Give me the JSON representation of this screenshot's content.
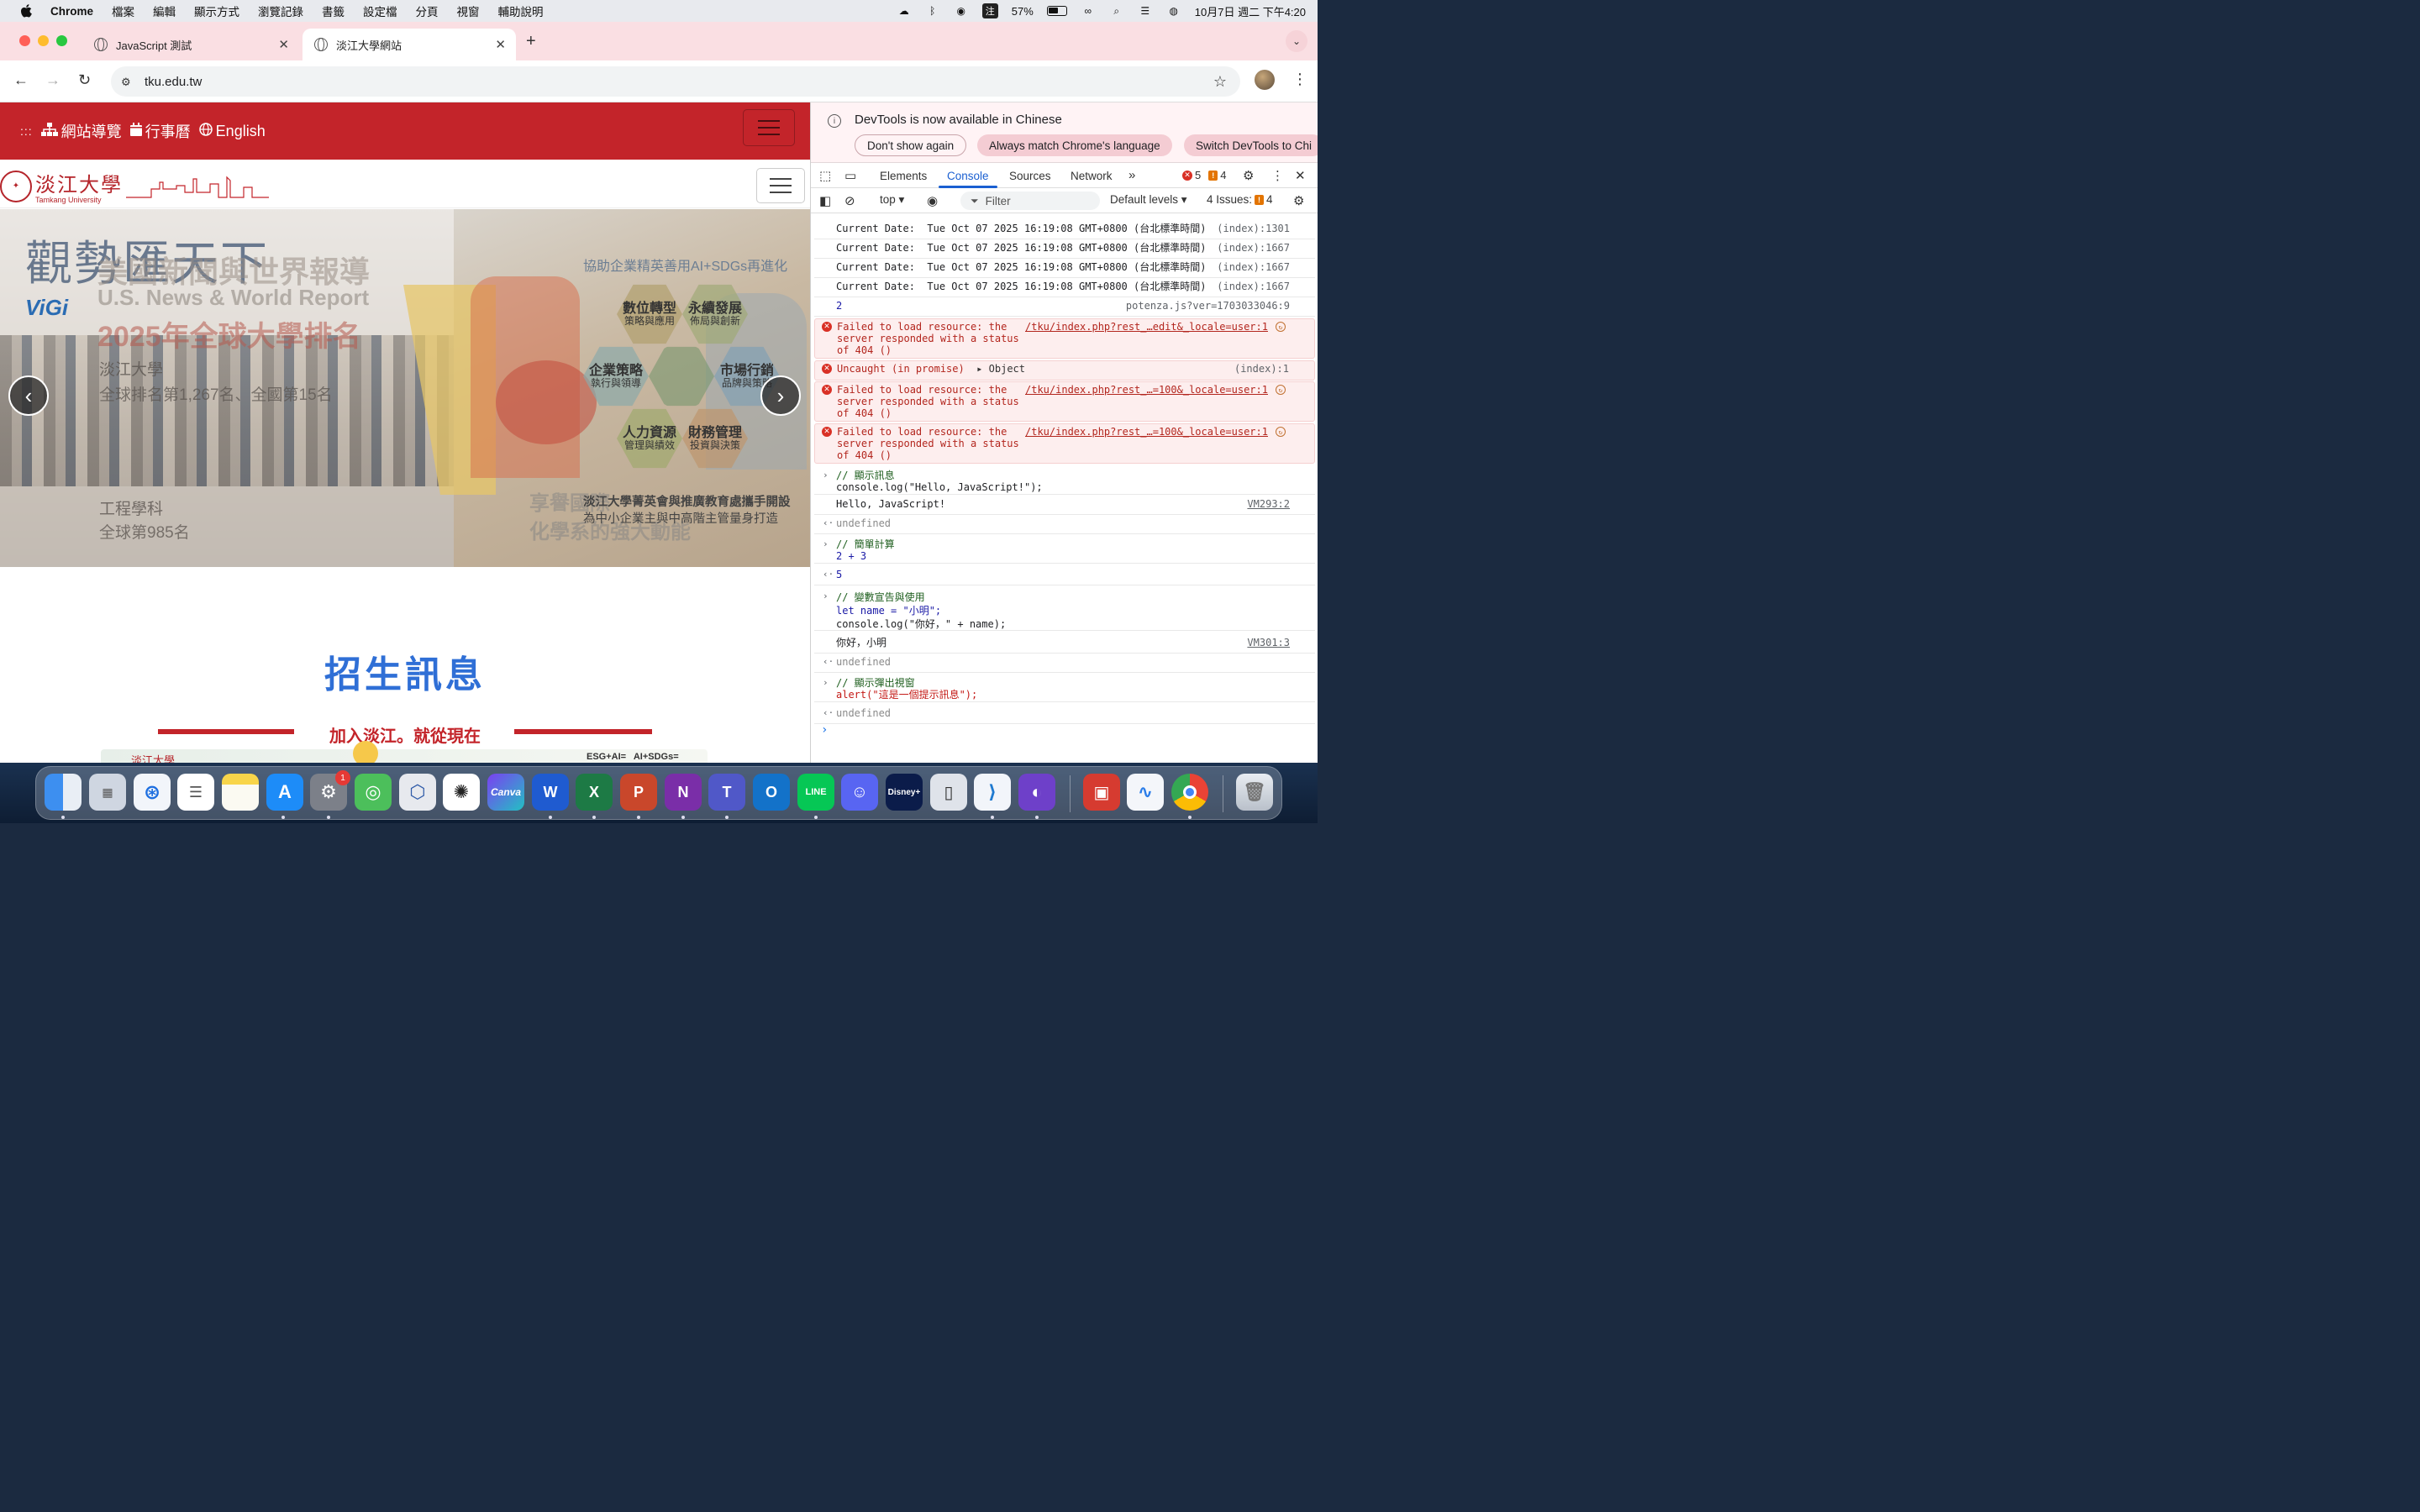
{
  "menubar": {
    "app": "Chrome",
    "items": [
      "檔案",
      "編輯",
      "顯示方式",
      "瀏覽記錄",
      "書籤",
      "設定檔",
      "分頁",
      "視窗",
      "輔助說明"
    ],
    "ime": "注",
    "battery": "57%",
    "datetime": "10月7日 週二 下午4:20"
  },
  "browser": {
    "tabs": [
      {
        "title": "JavaScript 測試",
        "active": false
      },
      {
        "title": "淡江大學網站",
        "active": true
      }
    ],
    "url": "tku.edu.tw"
  },
  "site": {
    "nav": {
      "sitemap": "網站導覽",
      "calendar": "行事曆",
      "english": "English"
    },
    "logo": {
      "zh": "淡江大學",
      "en": "Tamkang University"
    },
    "carousel": {
      "headline_script": "觀勢匯天下",
      "headline_gray": "美國新聞與世界報導",
      "usnews": "U.S. News & World Report",
      "rank_title": "2025年全球大學排名",
      "uni": "淡江大學",
      "uni_rank": "全球排名第1,267名、全國第15名",
      "eng": "工程學科",
      "eng_rank": "全球第985名",
      "vigi": "ViGi",
      "tagline": "協助企業精英善用AI+SDGs再進化",
      "hexes": [
        {
          "title": "數位轉型",
          "sub": "策略與應用"
        },
        {
          "title": "永續發展",
          "sub": "佈局與創新"
        },
        {
          "title": "企業策略",
          "sub": "執行與領導"
        },
        {
          "title": "市場行銷",
          "sub": "品牌與策略"
        },
        {
          "title": "人力資源",
          "sub": "管理與績效"
        },
        {
          "title": "財務管理",
          "sub": "投資與決策"
        }
      ],
      "footer1": "淡江大學菁英會與推廣教育處攜手開設",
      "footer2": "為中小企業主與中高階主管量身打造",
      "footer_bg1": "享譽國際",
      "footer_bg2": "化學系的強大動能"
    },
    "admission": {
      "title": "招生訊息",
      "subtitle": "加入淡江。就從現在"
    },
    "banner_text": "ESG+AI=   AI+SDGs="
  },
  "devtools": {
    "infobar": {
      "message": "DevTools is now available in Chinese",
      "btn1": "Don't show again",
      "btn2": "Always match Chrome's language",
      "btn3": "Switch DevTools to Chi"
    },
    "tabs": [
      "Elements",
      "Console",
      "Sources",
      "Network"
    ],
    "active_tab": "Console",
    "errors": "5",
    "warnings": "4",
    "context": "top",
    "filter_placeholder": "Filter",
    "levels": "Default levels",
    "issues_label": "4 Issues:",
    "issues_count": "4",
    "logs": [
      {
        "text": "Current Date:  Tue Oct 07 2025 16:19:08 GMT+0800 (台北標準時間)",
        "src": "(index):1301"
      },
      {
        "text": "Current Date:  Tue Oct 07 2025 16:19:08 GMT+0800 (台北標準時間)",
        "src": "(index):1667"
      },
      {
        "text": "Current Date:  Tue Oct 07 2025 16:19:08 GMT+0800 (台北標準時間)",
        "src": "(index):1667"
      },
      {
        "text": "Current Date:  Tue Oct 07 2025 16:19:08 GMT+0800 (台北標準時間)",
        "src": "(index):1667"
      },
      {
        "text": "2",
        "src": "potenza.js?ver=1703033046:9"
      }
    ],
    "errors_list": [
      {
        "l1": "Failed to load resource: the",
        "l2": "server responded with a status",
        "l3": "of 404 ()",
        "src": "/tku/index.php?rest_…edit&_locale=user:1"
      },
      {
        "l1": "Uncaught (in promise)",
        "obj": "Object",
        "src": "(index):1"
      },
      {
        "l1": "Failed to load resource: the",
        "l2": "server responded with a status",
        "l3": "of 404 ()",
        "src": "/tku/index.php?rest_…=100&_locale=user:1"
      },
      {
        "l1": "Failed to load resource: the",
        "l2": "server responded with a status",
        "l3": "of 404 ()",
        "src": "/tku/index.php?rest_…=100&_locale=user:1"
      }
    ],
    "session": {
      "c1_comment": "// 顯示訊息",
      "c1_code": "console.log(\"Hello, JavaScript!\");",
      "c1_out": "Hello, JavaScript!",
      "c1_src": "VM293:2",
      "undef": "undefined",
      "c2_comment": "// 簡單計算",
      "c2_code": "2 + 3",
      "c2_out": "5",
      "c3_comment": "// 變數宣告與使用",
      "c3_code1": "let name = \"小明\";",
      "c3_code2": "console.log(\"你好，\" + name);",
      "c3_out": "你好，小明",
      "c3_src": "VM301:3",
      "c4_comment": "// 顯示彈出視窗",
      "c4_code": "alert(\"這是一個提示訊息\");"
    }
  },
  "dock": {
    "apps": [
      "finder",
      "launchpad",
      "safari",
      "reminders",
      "notes",
      "app-store",
      "system-settings",
      "find-my",
      "virtualbox",
      "chatgpt",
      "canva",
      "word",
      "excel",
      "powerpoint",
      "onenote",
      "teams",
      "outlook",
      "line",
      "discord",
      "disney-plus",
      "iphone-mirroring",
      "vscode",
      "github-desktop",
      "photo-booth",
      "freeform",
      "chrome",
      "trash"
    ],
    "settings_badge": "1",
    "labels": {
      "canva": "Canva",
      "word": "W",
      "excel": "X",
      "powerpoint": "P",
      "onenote": "N",
      "outlook": "O",
      "line": "LINE",
      "disney": "Disney+"
    }
  },
  "colors": {
    "tku_red": "#c3242a",
    "admission_blue": "#2f6fd6",
    "devtools_blue": "#1a5fd1",
    "error_red": "#d93025"
  }
}
